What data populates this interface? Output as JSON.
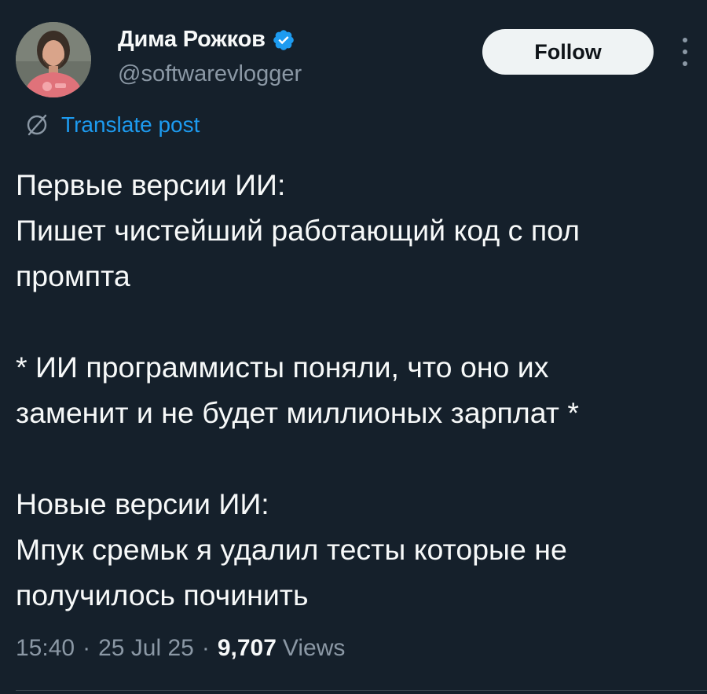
{
  "author": {
    "display_name": "Дима Рожков",
    "handle": "@softwarevlogger",
    "verified": true,
    "verified_color": "#1d9bf0"
  },
  "actions": {
    "follow_label": "Follow",
    "more_icon": "more-vertical-icon"
  },
  "translate": {
    "label": "Translate post",
    "icon": "translate-globe-icon",
    "color": "#1d9bf0"
  },
  "post": {
    "lines": [
      "Первые версии ИИ:",
      "Пишет чистейший работающий код с пол",
      "промпта",
      "",
      "* ИИ программисты поняли, что оно их",
      "заменит и не будет миллионых зарплат *",
      "",
      "Новые версии ИИ:",
      "Мпук сремьк я удалил тесты которые не",
      "получилось починить"
    ]
  },
  "meta": {
    "time": "15:40",
    "date": "25 Jul 25",
    "views_count": "9,707",
    "views_label": "Views",
    "separator": "·"
  },
  "colors": {
    "background": "#15202b",
    "text_primary": "#f7f9f9",
    "text_secondary": "#8b98a5",
    "accent": "#1d9bf0"
  }
}
